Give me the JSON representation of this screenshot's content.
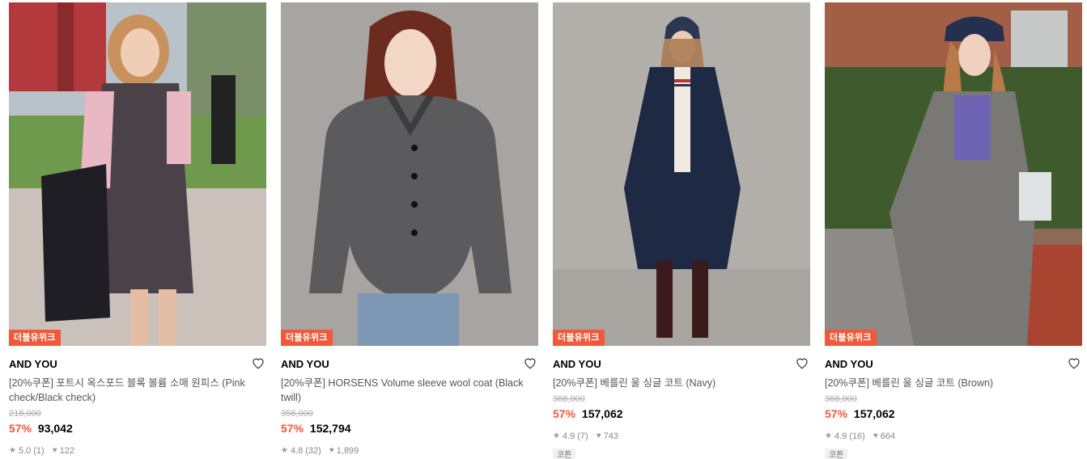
{
  "products": [
    {
      "badge": "더블유위크",
      "brand": "AND YOU",
      "name": "[20%쿠폰] 포트시 옥스포드 블록 볼륨 소매 원피스 (Pink check/Black check)",
      "original_price": "218,000",
      "discount": "57%",
      "price": "93,042",
      "rating": "5.0",
      "rating_count": "(1)",
      "likes": "122",
      "tag": ""
    },
    {
      "badge": "더블유위크",
      "brand": "AND YOU",
      "name": "[20%쿠폰] HORSENS Volume sleeve wool coat (Black twill)",
      "original_price": "358,000",
      "discount": "57%",
      "price": "152,794",
      "rating": "4.8",
      "rating_count": "(32)",
      "likes": "1,899",
      "tag": ""
    },
    {
      "badge": "더블유위크",
      "brand": "AND YOU",
      "name": "[20%쿠폰] 베를린 울 싱글 코트 (Navy)",
      "original_price": "368,000",
      "discount": "57%",
      "price": "157,062",
      "rating": "4.9",
      "rating_count": "(7)",
      "likes": "743",
      "tag": "코튼"
    },
    {
      "badge": "더블유위크",
      "brand": "AND YOU",
      "name": "[20%쿠폰] 베를린 울 싱글 코트 (Brown)",
      "original_price": "368,000",
      "discount": "57%",
      "price": "157,062",
      "rating": "4.9",
      "rating_count": "(16)",
      "likes": "664",
      "tag": "코튼"
    }
  ],
  "icons": {
    "heart": "heart-outline-icon",
    "star": "star-icon",
    "like": "heart-filled-icon"
  },
  "colors": {
    "accent": "#f0593a"
  }
}
